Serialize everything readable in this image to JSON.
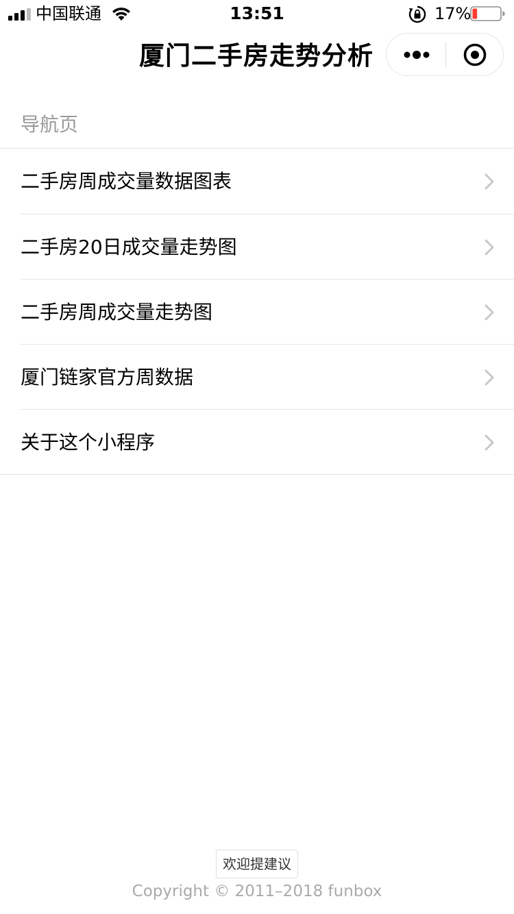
{
  "status_bar": {
    "carrier": "中国联通",
    "time": "13:51",
    "battery_percent": "17%",
    "battery_level": 0.17,
    "icons": [
      "signal-icon",
      "wifi-icon",
      "rotation-lock-icon",
      "battery-icon"
    ]
  },
  "nav": {
    "title": "厦门二手房走势分析",
    "more_icon": "more-dots-icon",
    "close_icon": "close-target-icon"
  },
  "section": {
    "header": "导航页"
  },
  "menu": {
    "items": [
      {
        "label": "二手房周成交量数据图表"
      },
      {
        "label": "二手房20日成交量走势图"
      },
      {
        "label": "二手房周成交量走势图"
      },
      {
        "label": "厦门链家官方周数据"
      },
      {
        "label": "关于这个小程序"
      }
    ],
    "chevron_icon": "chevron-right-icon"
  },
  "footer": {
    "feedback_label": "欢迎提建议",
    "copyright": "Copyright © 2011–2018 funbox"
  },
  "colors": {
    "battery_low": "#ff3b30",
    "secondary_text": "#999999",
    "separator": "#e5e5e5",
    "chevron": "#c7c7cc"
  }
}
